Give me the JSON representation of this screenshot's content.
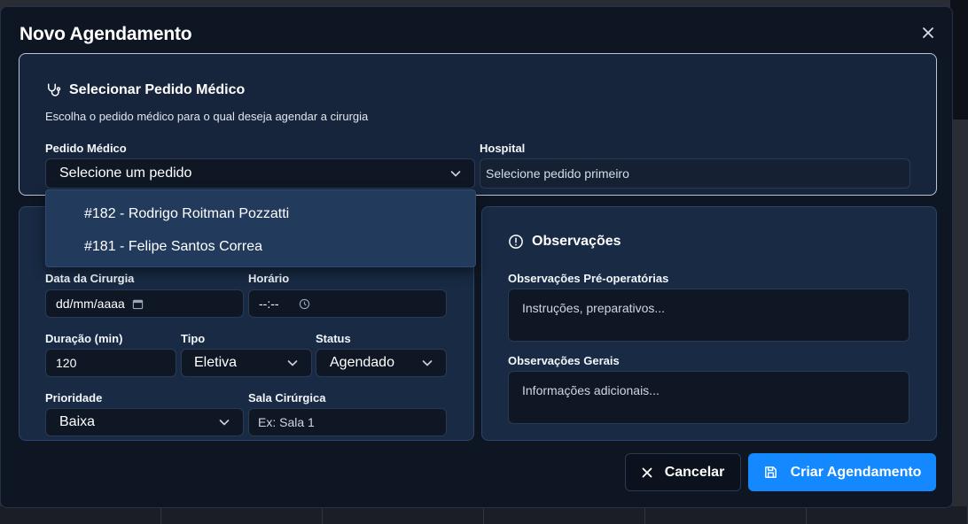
{
  "modal": {
    "title": "Novo Agendamento"
  },
  "pedido_section": {
    "title": "Selecionar Pedido Médico",
    "description": "Escolha o pedido médico para o qual deseja agendar a cirurgia",
    "pedido_label": "Pedido Médico",
    "pedido_value": "Selecione um pedido",
    "hospital_label": "Hospital",
    "hospital_value": "Selecione pedido primeiro"
  },
  "dropdown": {
    "items": [
      {
        "label": "#182 - Rodrigo Roitman Pozzatti"
      },
      {
        "label": "#181 - Felipe Santos Correa"
      }
    ]
  },
  "schedule": {
    "data_label": "Data da Cirurgia",
    "data_placeholder": "dd/mm/aaaa",
    "horario_label": "Horário",
    "horario_placeholder": "--:--",
    "duracao_label": "Duração (min)",
    "duracao_value": "120",
    "tipo_label": "Tipo",
    "tipo_value": "Eletiva",
    "status_label": "Status",
    "status_value": "Agendado",
    "prioridade_label": "Prioridade",
    "prioridade_value": "Baixa",
    "sala_label": "Sala Cirúrgica",
    "sala_placeholder": "Ex: Sala 1"
  },
  "observacoes": {
    "title": "Observações",
    "pre_label": "Observações Pré-operatórias",
    "pre_placeholder": "Instruções, preparativos...",
    "gerais_label": "Observações Gerais",
    "gerais_placeholder": "Informações adicionais..."
  },
  "actions": {
    "cancel_label": "Cancelar",
    "submit_label": "Criar Agendamento"
  },
  "colors": {
    "primary": "#1489ff",
    "modal_bg": "#0f1623",
    "card_bg": "#182a44",
    "dropdown_bg": "#223b5c"
  },
  "icons": [
    "close-icon",
    "stethoscope-icon",
    "chevron-down-icon",
    "calendar-icon",
    "clock-icon",
    "alert-circle-icon",
    "x-icon",
    "save-icon"
  ]
}
